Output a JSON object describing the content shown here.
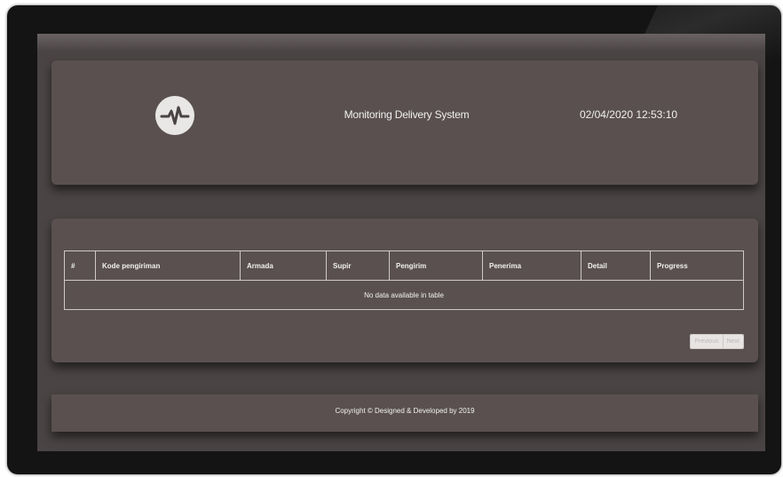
{
  "header": {
    "logo_icon": "heartbeat-pulse-icon",
    "title": "Monitoring Delivery System",
    "datetime": "02/04/2020 12:53:10"
  },
  "table": {
    "columns": [
      "#",
      "Kode pengiriman",
      "Armada",
      "Supir",
      "Pengirim",
      "Penerima",
      "Detail",
      "Progress"
    ],
    "empty_message": "No data available in table"
  },
  "pager": {
    "previous_label": "Previous",
    "next_label": "Next"
  },
  "footer": {
    "copyright_prefix": "Copyright © Designed & Developed by ",
    "author": "",
    "year": " 2019"
  },
  "colors": {
    "panel": "#5a5050",
    "screen": "#4a4444",
    "bezel": "#141414",
    "author_link": "#6a5ad8"
  }
}
